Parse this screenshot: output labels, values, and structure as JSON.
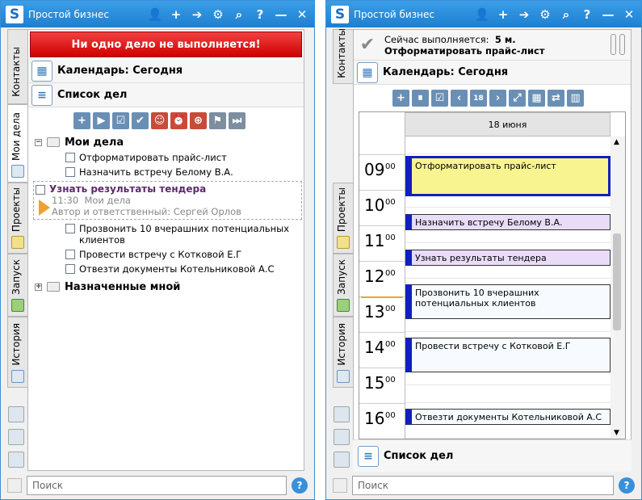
{
  "app_title": "Простой бизнес",
  "titlebar_icons": [
    "user-icon",
    "plus-icon",
    "arrow-right-icon",
    "gear-icon",
    "search-icon",
    "help-icon",
    "minimize-icon",
    "close-icon"
  ],
  "left": {
    "tabs": [
      "Контакты",
      "Мои дела",
      "Проекты",
      "Запуск",
      "История"
    ],
    "status_banner": "Ни одно дело не выполняется!",
    "calendar_title": "Календарь: Сегодня",
    "tasks_title": "Список дел",
    "toolbar": [
      "+",
      "▶",
      "☑",
      "✔",
      "☺",
      "⏰",
      "⊕",
      "⚑",
      "⏭"
    ],
    "tree": {
      "group1": "Мои дела",
      "group1_items": [
        "Отформатировать прайс-лист",
        "Назначить встречу Белому В.А."
      ],
      "selected": {
        "title": "Узнать результаты тендера",
        "time": "11:30",
        "folder": "Мои дела",
        "author_line": "Автор и ответственный: Сергей Орлов"
      },
      "after_items": [
        "Прозвонить 10 вчерашних потенциальных клиентов",
        "Провести встречу с Котковой Е.Г",
        "Отвезти документы Котельниковой А.С"
      ],
      "group2": "Назначенные мной"
    },
    "search_placeholder": "Поиск"
  },
  "right": {
    "tabs": [
      "Контакты",
      "Проекты",
      "Запуск",
      "История"
    ],
    "current_prefix": "Сейчас выполняется:",
    "current_elapsed": "5 м.",
    "current_task": "Отформатировать прайс-лист",
    "calendar_title": "Календарь: Сегодня",
    "toolbar": [
      "+",
      "⏸",
      "☑",
      "‹",
      "18",
      "›",
      "⤢",
      "▦",
      "⇄",
      "▥"
    ],
    "day_header": "18 июня",
    "hours": [
      {
        "h": "09",
        "m": "00"
      },
      {
        "h": "10",
        "m": "00"
      },
      {
        "h": "11",
        "m": "00"
      },
      {
        "h": "12",
        "m": "00"
      },
      {
        "h": "13",
        "m": "00"
      },
      {
        "h": "14",
        "m": "00"
      },
      {
        "h": "15",
        "m": "00"
      },
      {
        "h": "16",
        "m": "00"
      }
    ],
    "events": [
      {
        "text": "Отформатировать прайс-лист",
        "color": "#f8f490"
      },
      {
        "text": "Назначить встречу Белому В.А.",
        "color": "#e9dcf8"
      },
      {
        "text": "Узнать результаты тендера",
        "color": "#e9dcf8"
      },
      {
        "text": "Прозвонить 10 вчерашних потенциальных клиентов",
        "color": "#f7fbff"
      },
      {
        "text": "Провести встречу с Котковой Е.Г",
        "color": "#f7fbff"
      },
      {
        "text": "Отвезти документы Котельниковой А.С",
        "color": "#f7fbff"
      }
    ],
    "tasks_title": "Список дел",
    "search_placeholder": "Поиск"
  }
}
